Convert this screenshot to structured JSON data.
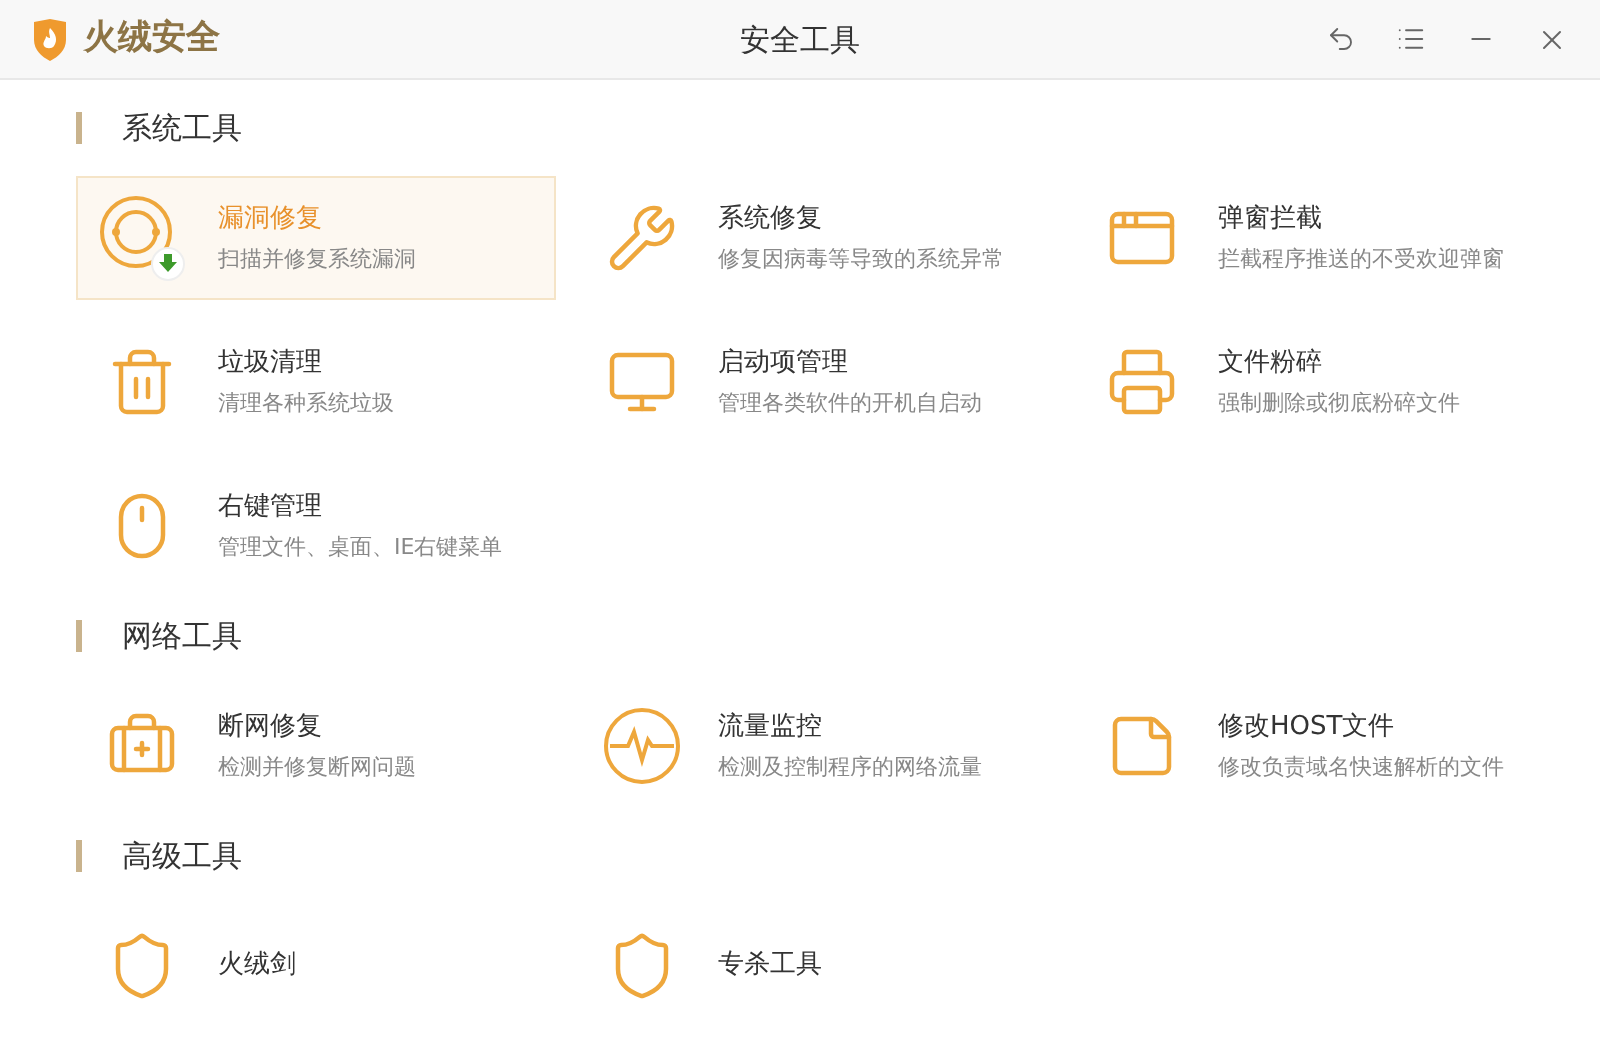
{
  "window": {
    "app_name": "火绒安全",
    "title": "安全工具"
  },
  "sections": [
    {
      "title": "系统工具",
      "items": [
        {
          "title": "漏洞修复",
          "desc": "扫描并修复系统漏洞",
          "selected": true
        },
        {
          "title": "系统修复",
          "desc": "修复因病毒等导致的系统异常",
          "selected": false
        },
        {
          "title": "弹窗拦截",
          "desc": "拦截程序推送的不受欢迎弹窗",
          "selected": false
        },
        {
          "title": "垃圾清理",
          "desc": "清理各种系统垃圾",
          "selected": false
        },
        {
          "title": "启动项管理",
          "desc": "管理各类软件的开机自启动",
          "selected": false
        },
        {
          "title": "文件粉碎",
          "desc": "强制删除或彻底粉碎文件",
          "selected": false
        },
        {
          "title": "右键管理",
          "desc": "管理文件、桌面、IE右键菜单",
          "selected": false
        }
      ]
    },
    {
      "title": "网络工具",
      "items": [
        {
          "title": "断网修复",
          "desc": "检测并修复断网问题",
          "selected": false
        },
        {
          "title": "流量监控",
          "desc": "检测及控制程序的网络流量",
          "selected": false
        },
        {
          "title": "修改HOST文件",
          "desc": "修改负责域名快速解析的文件",
          "selected": false
        }
      ]
    },
    {
      "title": "高级工具",
      "items": [
        {
          "title": "火绒剑",
          "selected": false
        },
        {
          "title": "专杀工具",
          "selected": false
        }
      ]
    }
  ]
}
